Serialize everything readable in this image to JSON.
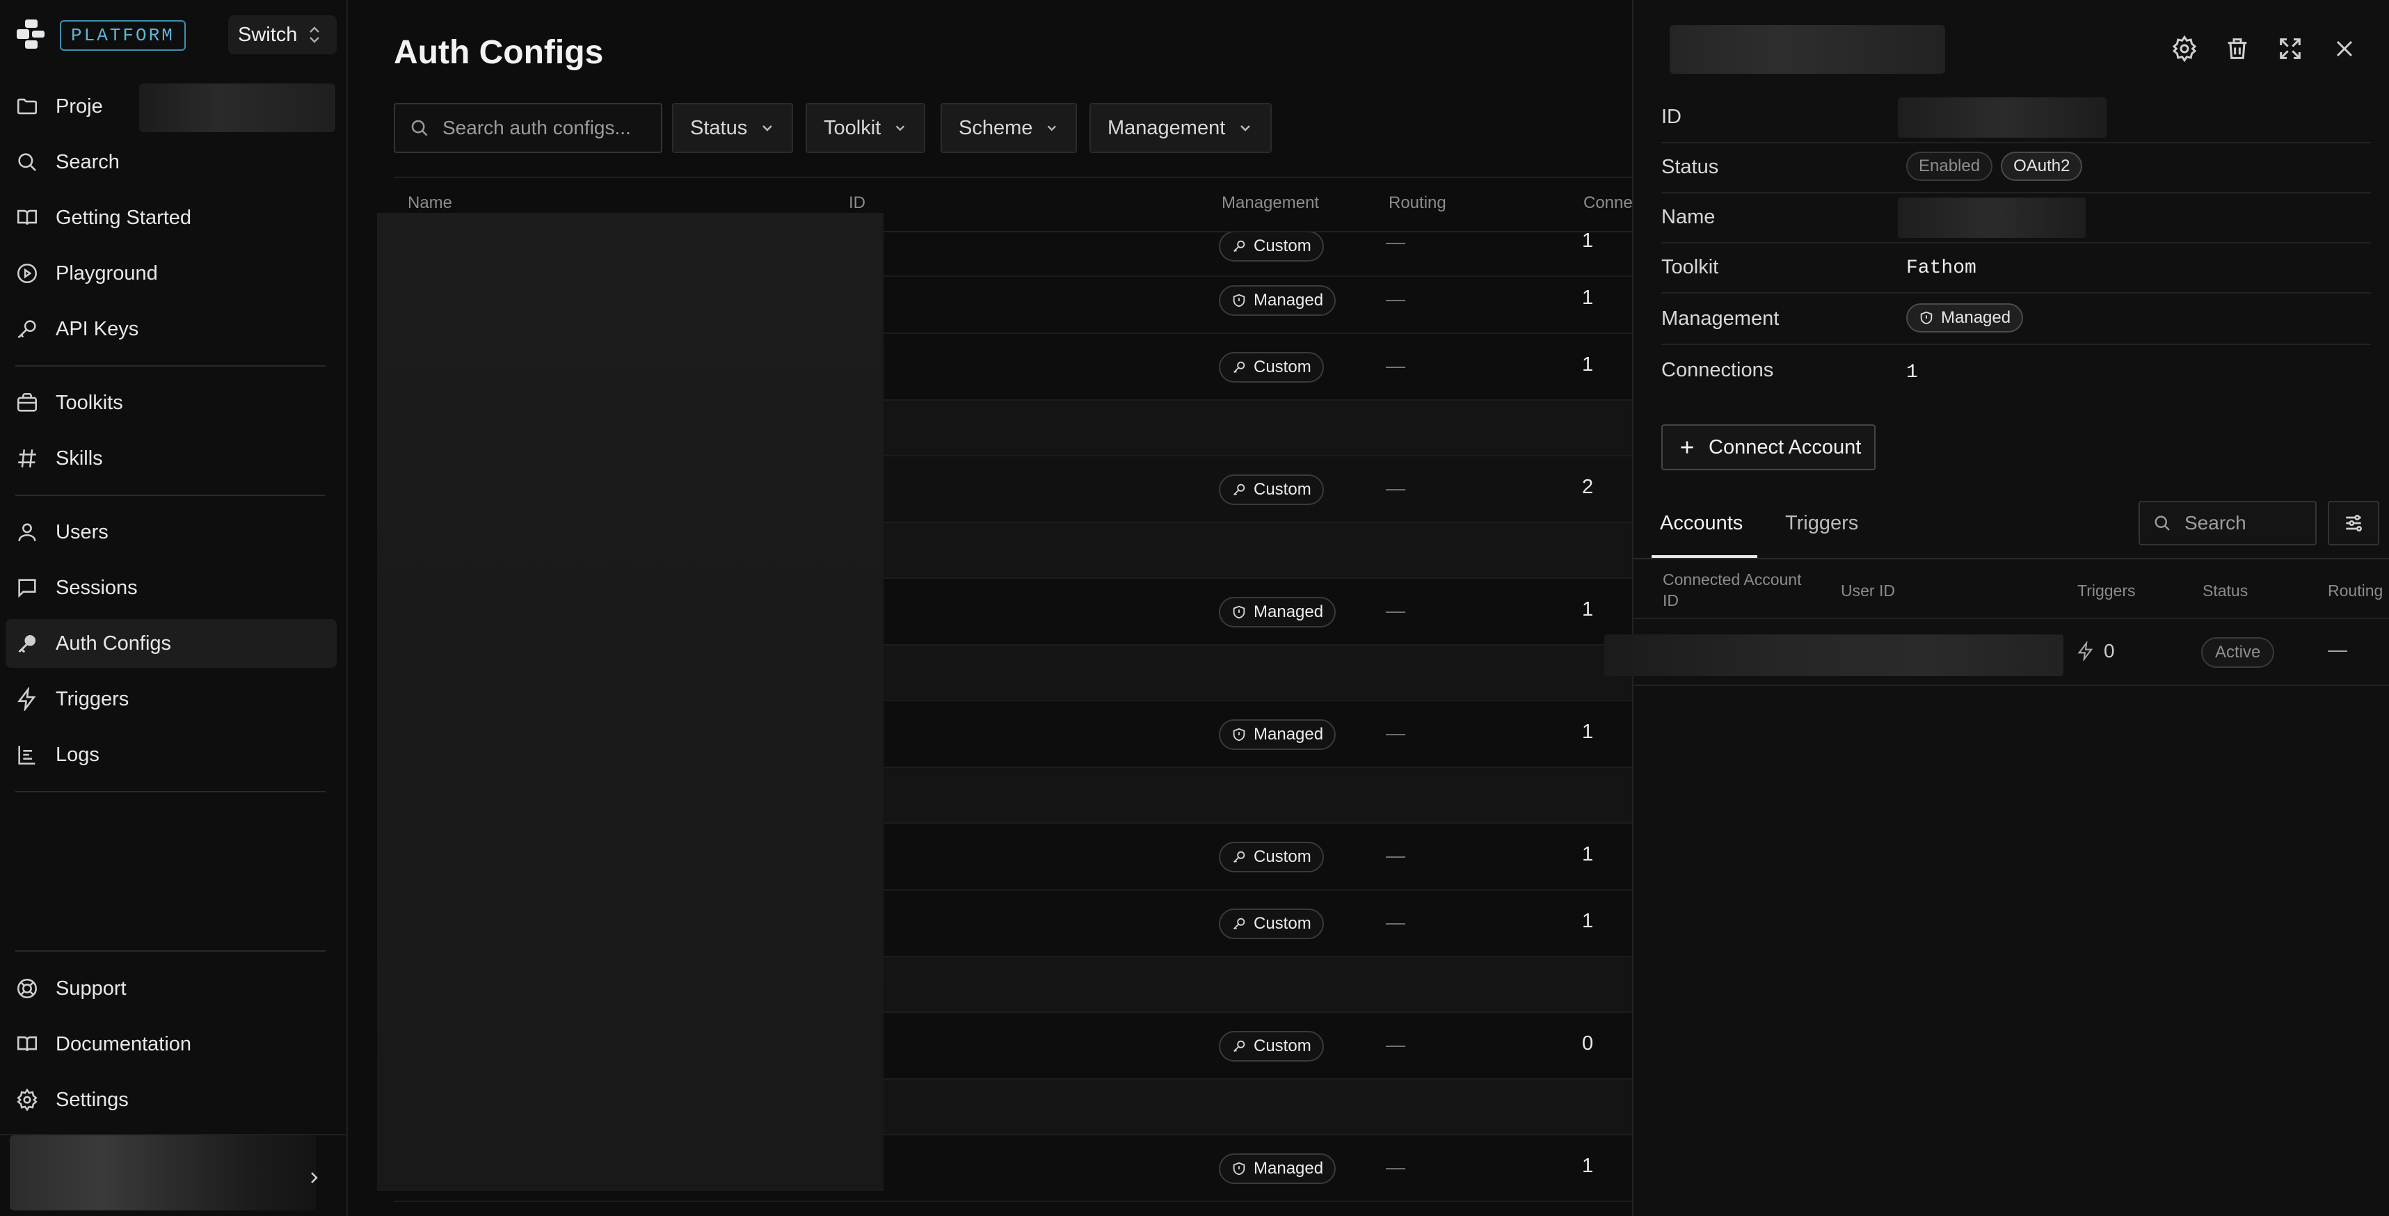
{
  "sidebar": {
    "brand": "PLATFORM",
    "switch_label": "Switch",
    "nav_main": [
      {
        "label": "Proje"
      },
      {
        "label": "Search"
      },
      {
        "label": "Getting Started"
      },
      {
        "label": "Playground"
      },
      {
        "label": "API Keys"
      }
    ],
    "nav_tools": [
      {
        "label": "Toolkits"
      },
      {
        "label": "Skills"
      }
    ],
    "nav_data": [
      {
        "label": "Users"
      },
      {
        "label": "Sessions"
      },
      {
        "label": "Auth Configs"
      },
      {
        "label": "Triggers"
      },
      {
        "label": "Logs"
      }
    ],
    "nav_bottom": [
      {
        "label": "Support"
      },
      {
        "label": "Documentation"
      },
      {
        "label": "Settings"
      }
    ]
  },
  "main": {
    "title": "Auth Configs",
    "search_placeholder": "Search auth configs...",
    "filters": [
      {
        "label": "Status"
      },
      {
        "label": "Toolkit"
      },
      {
        "label": "Scheme"
      },
      {
        "label": "Management"
      }
    ],
    "columns": {
      "name": "Name",
      "id": "ID",
      "management": "Management",
      "routing": "Routing",
      "connections": "Conne"
    },
    "rows": [
      {
        "management": "Custom",
        "icon": "key-icon",
        "routing": "—",
        "connections": "1"
      },
      {
        "management": "Managed",
        "icon": "shield-icon",
        "routing": "—",
        "connections": "1"
      },
      {
        "management": "Custom",
        "icon": "key-icon",
        "routing": "—",
        "connections": "1"
      },
      {
        "management": "Custom",
        "icon": "key-icon",
        "routing": "—",
        "connections": "2"
      },
      {
        "management": "Managed",
        "icon": "shield-icon",
        "routing": "—",
        "connections": "1"
      },
      {
        "management": "Managed",
        "icon": "shield-icon",
        "routing": "—",
        "connections": "1"
      },
      {
        "management": "Custom",
        "icon": "key-icon",
        "routing": "—",
        "connections": "1"
      },
      {
        "management": "Custom",
        "icon": "key-icon",
        "routing": "—",
        "connections": "1"
      },
      {
        "management": "Custom",
        "icon": "key-icon",
        "routing": "—",
        "connections": "0"
      },
      {
        "management": "Managed",
        "icon": "shield-icon",
        "routing": "—",
        "connections": "1"
      }
    ]
  },
  "panel": {
    "props": {
      "id_label": "ID",
      "status_label": "Status",
      "status_enabled": "Enabled",
      "status_scheme": "OAuth2",
      "name_label": "Name",
      "toolkit_label": "Toolkit",
      "toolkit_value": "Fathom",
      "management_label": "Management",
      "management_value": "Managed",
      "connections_label": "Connections",
      "connections_value": "1"
    },
    "connect_label": "Connect Account",
    "tabs": {
      "accounts": "Accounts",
      "triggers": "Triggers"
    },
    "search_placeholder": "Search",
    "accounts_columns": {
      "connected_id_1": "Connected Account",
      "connected_id_2": "ID",
      "user_id": "User ID",
      "triggers": "Triggers",
      "status": "Status",
      "routing": "Routing"
    },
    "account_row": {
      "triggers": "0",
      "status": "Active",
      "routing": "—"
    }
  }
}
